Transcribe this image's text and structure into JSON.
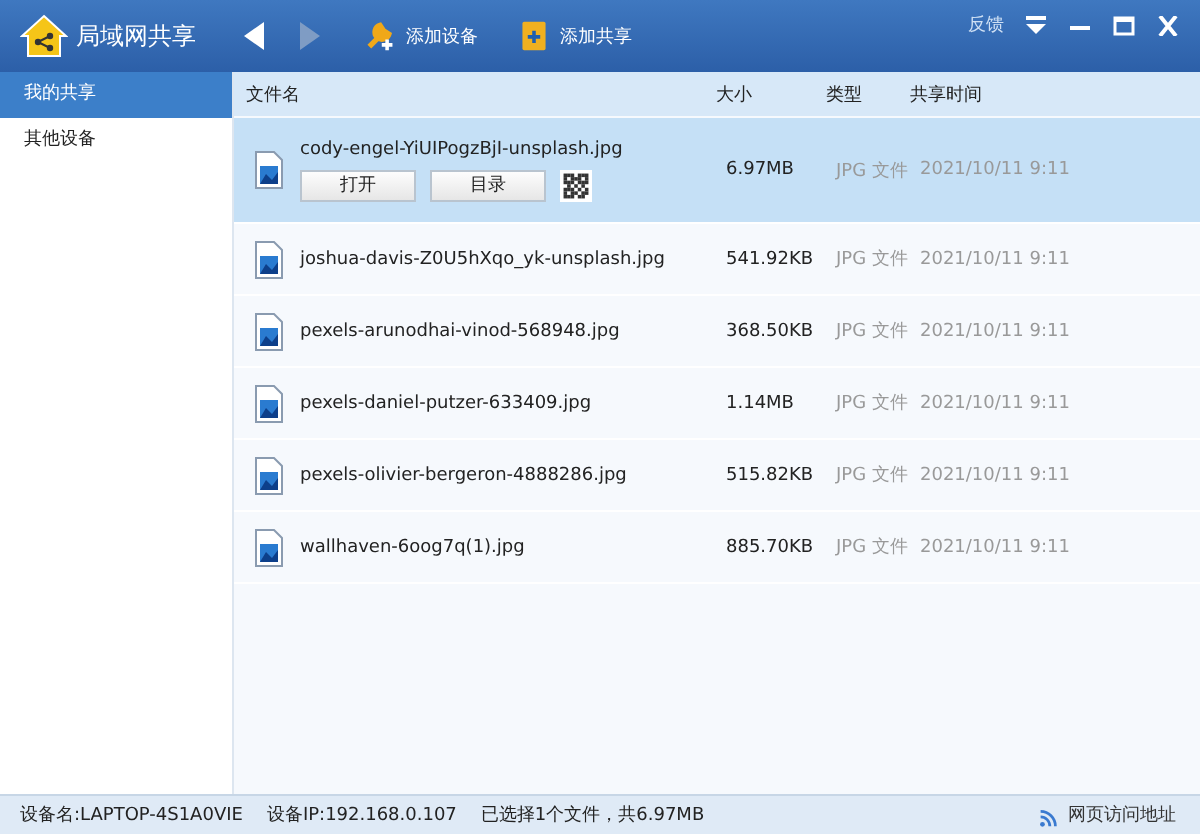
{
  "window": {
    "title": "局域网共享",
    "feedback": "反馈"
  },
  "toolbar": [
    {
      "kind": "back",
      "disabled": false
    },
    {
      "kind": "forward",
      "disabled": true
    },
    {
      "kind": "add-device",
      "label": "添加设备",
      "disabled": false
    },
    {
      "kind": "add-share",
      "label": "添加共享",
      "disabled": false
    }
  ],
  "sidebar": {
    "items": [
      {
        "label": "我的共享",
        "selected": true
      },
      {
        "label": "其他设备",
        "selected": false
      }
    ]
  },
  "table": {
    "columns": [
      "文件名",
      "大小",
      "类型",
      "共享时间"
    ],
    "rows": [
      {
        "name": "cody-engel-YiUIPogzBjI-unsplash.jpg",
        "size": "6.97MB",
        "type": "JPG 文件",
        "time": "2021/10/11 9:11",
        "selected": true,
        "actions": [
          "打开",
          "目录"
        ]
      },
      {
        "name": "joshua-davis-Z0U5hXqo_yk-unsplash.jpg",
        "size": "541.92KB",
        "type": "JPG 文件",
        "time": "2021/10/11 9:11",
        "selected": false
      },
      {
        "name": "pexels-arunodhai-vinod-568948.jpg",
        "size": "368.50KB",
        "type": "JPG 文件",
        "time": "2021/10/11 9:11",
        "selected": false
      },
      {
        "name": "pexels-daniel-putzer-633409.jpg",
        "size": "1.14MB",
        "type": "JPG 文件",
        "time": "2021/10/11 9:11",
        "selected": false
      },
      {
        "name": "pexels-olivier-bergeron-4888286.jpg",
        "size": "515.82KB",
        "type": "JPG 文件",
        "time": "2021/10/11 9:11",
        "selected": false
      },
      {
        "name": "wallhaven-6oog7q(1).jpg",
        "size": "885.70KB",
        "type": "JPG 文件",
        "time": "2021/10/11 9:11",
        "selected": false
      }
    ]
  },
  "status_bar": {
    "items": [
      "设备名:LAPTOP-4S1A0VIE",
      "设备IP:192.168.0.107",
      "已选择1个文件，共6.97MB"
    ],
    "link": "网页访问地址"
  }
}
